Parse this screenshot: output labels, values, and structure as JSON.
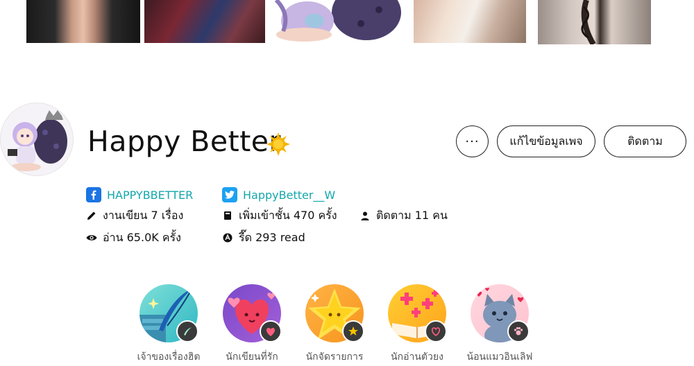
{
  "profile": {
    "name": "Happy Better",
    "more_label": "···",
    "edit_label": "แก้ไขข้อมูลเพจ",
    "follow_label": "ติดตาม"
  },
  "social": {
    "facebook": "HAPPYBBETTER",
    "twitter": "HappyBetter__W"
  },
  "stats": {
    "works": "งานเขียน 7 เรื่อง",
    "shelf": "เพิ่มเข้าชั้น 470 ครั้ง",
    "followers": "ติดตาม 11 คน",
    "reads": "อ่าน 65.0K ครั้ง",
    "cheers": "รี๊ด 293 read"
  },
  "badges": [
    {
      "label": "เจ้าของเรื่องฮิต",
      "icon": "quill-icon"
    },
    {
      "label": "นักเขียนที่รัก",
      "icon": "heart-icon"
    },
    {
      "label": "นักจัดรายการ",
      "icon": "star-icon"
    },
    {
      "label": "นักอ่านตัวยง",
      "icon": "book-icon"
    },
    {
      "label": "น้อนแมวอินเลิฟ",
      "icon": "cat-icon"
    }
  ],
  "colors": {
    "link": "#15a7ac",
    "facebook": "#1b74e4",
    "twitter": "#1da1f2",
    "verified": "#f5b400"
  }
}
